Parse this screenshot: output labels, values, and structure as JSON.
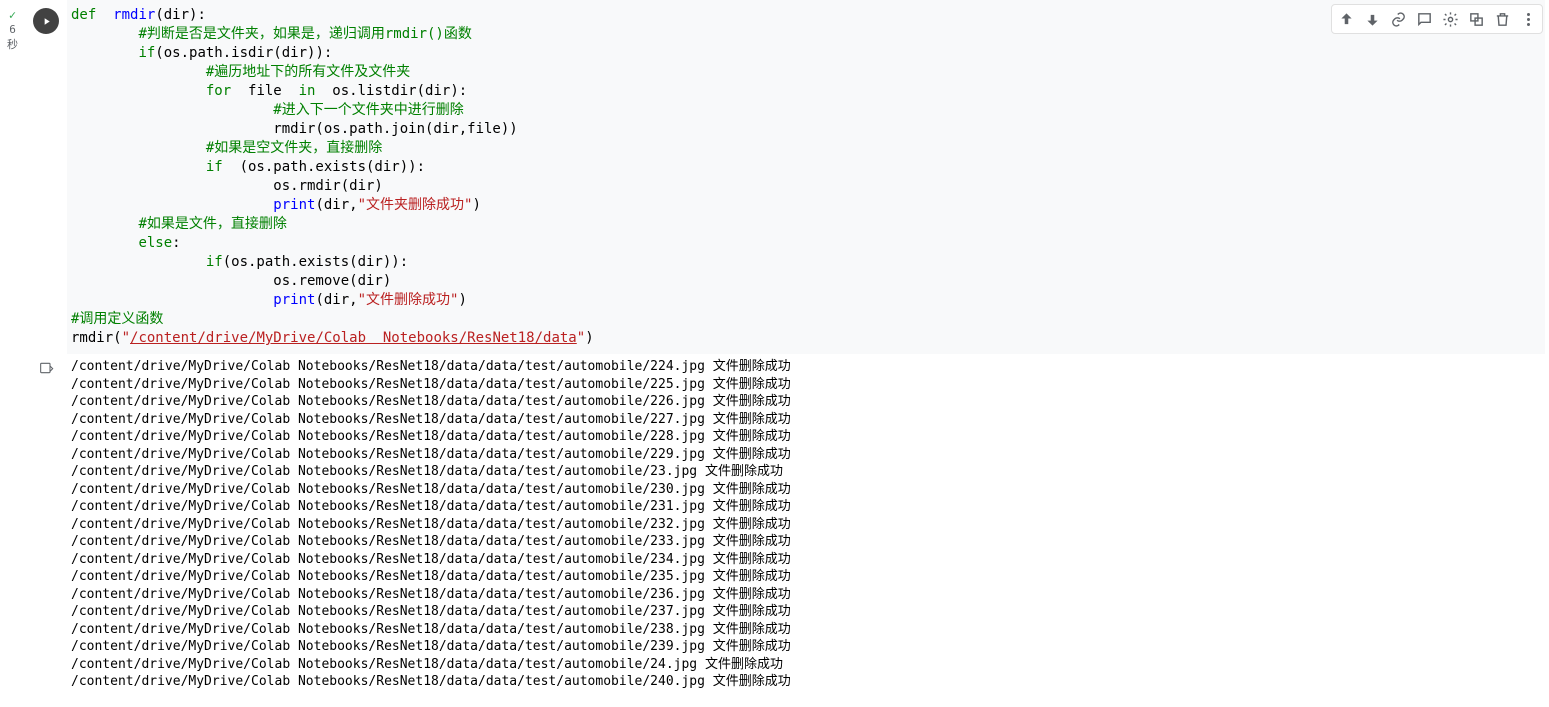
{
  "status": {
    "duration_label": "6",
    "duration_unit": "秒"
  },
  "toolbar": {
    "up": "↑",
    "down": "↓",
    "link": "⚭",
    "comment": "✎",
    "settings": "⚙",
    "mirror": "⧉",
    "delete": "🗑",
    "more": "⋮"
  },
  "code": {
    "tokens": [
      [
        {
          "t": "def",
          "c": "kw"
        },
        {
          "t": "  ",
          "c": ""
        },
        {
          "t": "rmdir",
          "c": "fn"
        },
        {
          "t": "(dir):",
          "c": ""
        }
      ],
      [
        {
          "t": "        ",
          "c": ""
        },
        {
          "t": "#判断是否是文件夹，如果是，递归调用rmdir()函数",
          "c": "cmt"
        }
      ],
      [
        {
          "t": "        ",
          "c": ""
        },
        {
          "t": "if",
          "c": "kw"
        },
        {
          "t": "(os.path.isdir(dir)):",
          "c": ""
        }
      ],
      [
        {
          "t": "                ",
          "c": ""
        },
        {
          "t": "#遍历地址下的所有文件及文件夹",
          "c": "cmt"
        }
      ],
      [
        {
          "t": "                ",
          "c": ""
        },
        {
          "t": "for",
          "c": "kw"
        },
        {
          "t": "  file  ",
          "c": ""
        },
        {
          "t": "in",
          "c": "kw"
        },
        {
          "t": "  os.listdir(dir):",
          "c": ""
        }
      ],
      [
        {
          "t": "                        ",
          "c": ""
        },
        {
          "t": "#进入下一个文件夹中进行删除",
          "c": "cmt"
        }
      ],
      [
        {
          "t": "                        rmdir(os.path.join(dir,file))",
          "c": ""
        }
      ],
      [
        {
          "t": "                ",
          "c": ""
        },
        {
          "t": "#如果是空文件夹，直接删除",
          "c": "cmt"
        }
      ],
      [
        {
          "t": "                ",
          "c": ""
        },
        {
          "t": "if",
          "c": "kw"
        },
        {
          "t": "  (os.path.exists(dir)):",
          "c": ""
        }
      ],
      [
        {
          "t": "                        os.rmdir(dir)",
          "c": ""
        }
      ],
      [
        {
          "t": "                        ",
          "c": ""
        },
        {
          "t": "print",
          "c": "fn"
        },
        {
          "t": "(dir,",
          "c": ""
        },
        {
          "t": "\"文件夹删除成功\"",
          "c": "str"
        },
        {
          "t": ")",
          "c": ""
        }
      ],
      [
        {
          "t": "        ",
          "c": ""
        },
        {
          "t": "#如果是文件，直接删除",
          "c": "cmt"
        }
      ],
      [
        {
          "t": "        ",
          "c": ""
        },
        {
          "t": "else",
          "c": "kw"
        },
        {
          "t": ":",
          "c": ""
        }
      ],
      [
        {
          "t": "                ",
          "c": ""
        },
        {
          "t": "if",
          "c": "kw"
        },
        {
          "t": "(os.path.exists(dir)):",
          "c": ""
        }
      ],
      [
        {
          "t": "                        os.remove(dir)",
          "c": ""
        }
      ],
      [
        {
          "t": "                        ",
          "c": ""
        },
        {
          "t": "print",
          "c": "fn"
        },
        {
          "t": "(dir,",
          "c": ""
        },
        {
          "t": "\"文件删除成功\"",
          "c": "str"
        },
        {
          "t": ")",
          "c": ""
        }
      ],
      [
        {
          "t": "#调用定义函数",
          "c": "cmt"
        }
      ],
      [
        {
          "t": "rmdir(",
          "c": ""
        },
        {
          "t": "\"",
          "c": "str"
        },
        {
          "t": "/content/drive/MyDrive/Colab  Notebooks/ResNet18/data",
          "c": "url"
        },
        {
          "t": "\"",
          "c": "str"
        },
        {
          "t": ")",
          "c": ""
        }
      ]
    ]
  },
  "output": {
    "lines": [
      "/content/drive/MyDrive/Colab Notebooks/ResNet18/data/data/test/automobile/224.jpg 文件删除成功",
      "/content/drive/MyDrive/Colab Notebooks/ResNet18/data/data/test/automobile/225.jpg 文件删除成功",
      "/content/drive/MyDrive/Colab Notebooks/ResNet18/data/data/test/automobile/226.jpg 文件删除成功",
      "/content/drive/MyDrive/Colab Notebooks/ResNet18/data/data/test/automobile/227.jpg 文件删除成功",
      "/content/drive/MyDrive/Colab Notebooks/ResNet18/data/data/test/automobile/228.jpg 文件删除成功",
      "/content/drive/MyDrive/Colab Notebooks/ResNet18/data/data/test/automobile/229.jpg 文件删除成功",
      "/content/drive/MyDrive/Colab Notebooks/ResNet18/data/data/test/automobile/23.jpg 文件删除成功",
      "/content/drive/MyDrive/Colab Notebooks/ResNet18/data/data/test/automobile/230.jpg 文件删除成功",
      "/content/drive/MyDrive/Colab Notebooks/ResNet18/data/data/test/automobile/231.jpg 文件删除成功",
      "/content/drive/MyDrive/Colab Notebooks/ResNet18/data/data/test/automobile/232.jpg 文件删除成功",
      "/content/drive/MyDrive/Colab Notebooks/ResNet18/data/data/test/automobile/233.jpg 文件删除成功",
      "/content/drive/MyDrive/Colab Notebooks/ResNet18/data/data/test/automobile/234.jpg 文件删除成功",
      "/content/drive/MyDrive/Colab Notebooks/ResNet18/data/data/test/automobile/235.jpg 文件删除成功",
      "/content/drive/MyDrive/Colab Notebooks/ResNet18/data/data/test/automobile/236.jpg 文件删除成功",
      "/content/drive/MyDrive/Colab Notebooks/ResNet18/data/data/test/automobile/237.jpg 文件删除成功",
      "/content/drive/MyDrive/Colab Notebooks/ResNet18/data/data/test/automobile/238.jpg 文件删除成功",
      "/content/drive/MyDrive/Colab Notebooks/ResNet18/data/data/test/automobile/239.jpg 文件删除成功",
      "/content/drive/MyDrive/Colab Notebooks/ResNet18/data/data/test/automobile/24.jpg 文件删除成功",
      "/content/drive/MyDrive/Colab Notebooks/ResNet18/data/data/test/automobile/240.jpg 文件删除成功"
    ]
  }
}
